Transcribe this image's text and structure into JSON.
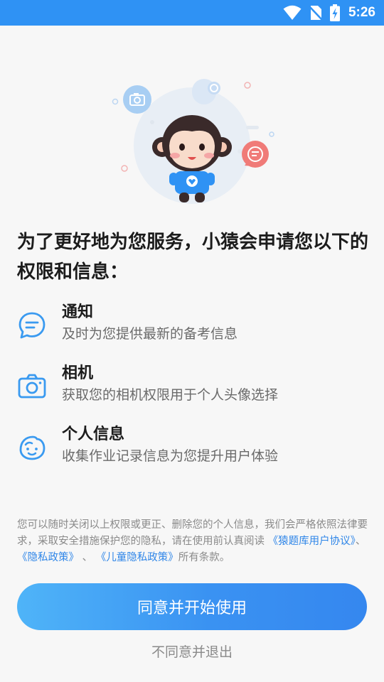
{
  "status_bar": {
    "time": "5:26",
    "icons": [
      "wifi-icon",
      "no-sim-icon",
      "battery-charging-icon"
    ],
    "background": "#2f92f4"
  },
  "hero": {
    "illustration": "monkey-mascot",
    "icons": [
      "camera-bubble-icon",
      "chat-bubble-icon"
    ]
  },
  "title": "为了更好地为您服务，小猿会申请您以下的权限和信息：",
  "permissions": [
    {
      "name": "通知",
      "desc": "及时为您提供最新的备考信息",
      "icon": "notification-chat-icon"
    },
    {
      "name": "相机",
      "desc": "获取您的相机权限用于个人头像选择",
      "icon": "camera-icon"
    },
    {
      "name": "个人信息",
      "desc": "收集作业记录信息为您提升用户体验",
      "icon": "face-icon"
    }
  ],
  "notice": {
    "text_before": "您可以随时关闭以上权限或更正、删除您的个人信息，我们会严格依照法律要求，采取安全措施保护您的隐私，请在使用前认真阅读",
    "link_1": "《猿题库用户协议》",
    "sep_1": "、",
    "link_2": "《隐私政策》",
    "sep_2": "、",
    "link_3": "《儿童隐私政策》",
    "text_after": "所有条款。"
  },
  "buttons": {
    "agree": "同意并开始使用",
    "reject": "不同意并退出"
  },
  "colors": {
    "accent": "#2f92f4",
    "link": "#2f86e8",
    "icon_blue": "#3a9af0"
  }
}
